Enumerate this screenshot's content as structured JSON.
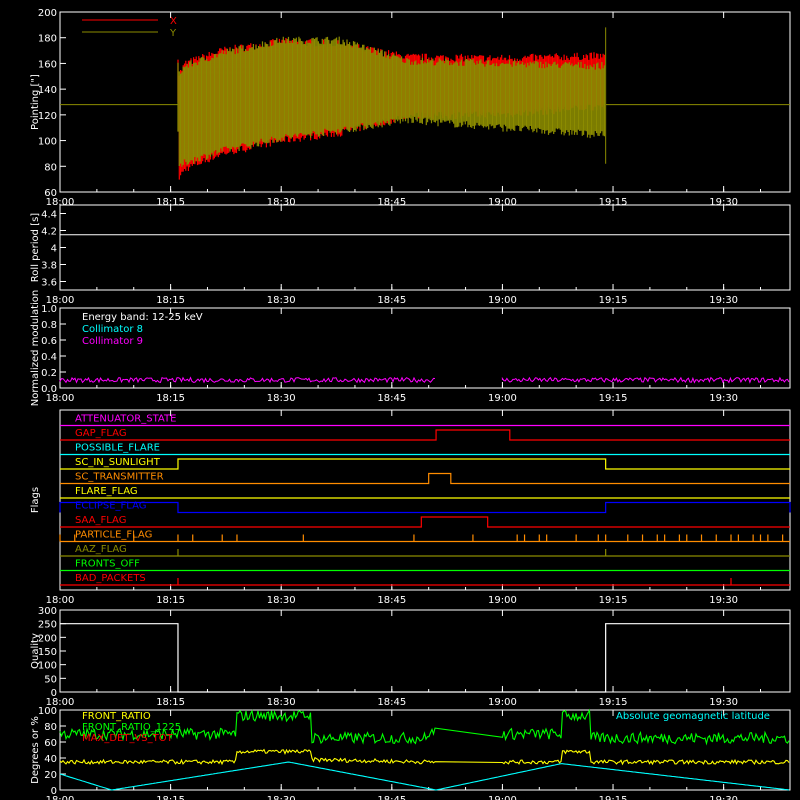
{
  "time_axis": {
    "start_min": 0,
    "end_min": 99,
    "tick_step_min": 15,
    "tick_labels": [
      "18:00",
      "18:15",
      "18:30",
      "18:45",
      "19:00",
      "19:15",
      "19:30"
    ]
  },
  "colors": {
    "x": "#ff0000",
    "y": "#8b8b00",
    "white": "#ffffff",
    "c8": "#00ffff",
    "c9": "#ff00ff",
    "green": "#00ff00",
    "yellow": "#ffff00",
    "orange": "#ff8c00",
    "blue": "#0000ff",
    "red": "#ff0000"
  },
  "chart_data": [
    {
      "type": "line",
      "ylabel": "Pointing [\"]",
      "ylim": [
        60,
        200
      ],
      "yticks": [
        60,
        80,
        100,
        120,
        140,
        160,
        180,
        200
      ],
      "legend": [
        {
          "name": "X",
          "color": "#ff0000"
        },
        {
          "name": "Y",
          "color": "#8b8b00"
        }
      ],
      "constant_before_after": 128,
      "data_interval_time": [
        "18:16",
        "19:14"
      ],
      "series": [
        {
          "name": "X",
          "envelope": {
            "time": [
              "18:16",
              "18:17",
              "18:22",
              "18:30",
              "18:38",
              "18:47",
              "19:00",
              "19:14"
            ],
            "upper": [
              150,
              160,
              170,
              177,
              175,
              165,
              164,
              166
            ],
            "lower": [
              70,
              78,
              90,
              100,
              106,
              119,
              120,
              127
            ]
          }
        },
        {
          "name": "Y",
          "envelope": {
            "time": [
              "18:16",
              "18:17",
              "18:22",
              "18:30",
              "18:38",
              "18:47",
              "19:00",
              "19:14"
            ],
            "upper": [
              152,
              158,
              168,
              178,
              178,
              162,
              160,
              158
            ],
            "lower": [
              78,
              83,
              92,
              102,
              108,
              116,
              110,
              104
            ]
          }
        }
      ]
    },
    {
      "type": "line",
      "ylabel": "Roll period [s]",
      "ylim": [
        3.5,
        4.5
      ],
      "yticks": [
        3.6,
        3.8,
        4.0,
        4.2,
        4.4
      ],
      "series": [
        {
          "name": "",
          "time": [
            "18:00",
            "19:39"
          ],
          "values": [
            4.15,
            4.15
          ]
        }
      ]
    },
    {
      "type": "line",
      "ylabel": "Normalized modulation",
      "ylim": [
        0,
        1
      ],
      "yticks": [
        0.0,
        0.2,
        0.4,
        0.6,
        0.8,
        1.0
      ],
      "legend_title": "Energy band: 12-25 keV",
      "legend": [
        {
          "name": "Collimator 8",
          "color": "#00ffff"
        },
        {
          "name": "Collimator 9",
          "color": "#ff00ff"
        }
      ],
      "segments": [
        {
          "start": "18:00",
          "end": "18:51",
          "level": 0.1
        },
        {
          "start": "19:00",
          "end": "19:39",
          "level": 0.1
        }
      ]
    },
    {
      "type": "line",
      "ylabel": "Flags",
      "flags": [
        {
          "name": "ATTENUATOR_STATE",
          "color": "#ff00ff",
          "high": []
        },
        {
          "name": "GAP_FLAG",
          "color": "#ff0000",
          "high": [
            [
              "18:51",
              "19:01"
            ]
          ]
        },
        {
          "name": "POSSIBLE_FLARE",
          "color": "#00ffff",
          "high": []
        },
        {
          "name": "SC_IN_SUNLIGHT",
          "color": "#ffff00",
          "high": [
            [
              "18:16",
              "19:14"
            ]
          ]
        },
        {
          "name": "SC_TRANSMITTER",
          "color": "#ff8c00",
          "high": [
            [
              "18:50",
              "18:53"
            ]
          ]
        },
        {
          "name": "FLARE_FLAG",
          "color": "#ffff00",
          "high": []
        },
        {
          "name": "ECLIPSE_FLAG",
          "color": "#0000ff",
          "high": [
            [
              "18:00",
              "18:16"
            ],
            [
              "19:14",
              "19:39"
            ]
          ]
        },
        {
          "name": "SAA_FLAG",
          "color": "#ff0000",
          "high": [
            [
              "18:49",
              "18:58"
            ]
          ]
        },
        {
          "name": "PARTICLE_FLAG",
          "color": "#ff8c00",
          "spikes_min": [
            0,
            2,
            10,
            16,
            18,
            22,
            24,
            33,
            48,
            56,
            62,
            63,
            65,
            66,
            70,
            73,
            74,
            77,
            79,
            81,
            82,
            84,
            85,
            87,
            89,
            91,
            92,
            94,
            95,
            96,
            98
          ]
        },
        {
          "name": "AAZ_FLAG",
          "color": "#8b8b00",
          "spikes_min": [
            16,
            74
          ]
        },
        {
          "name": "FRONTS_OFF",
          "color": "#00ff00",
          "high": []
        },
        {
          "name": "BAD_PACKETS",
          "color": "#ff0000",
          "spikes_min": [
            16,
            91
          ]
        }
      ]
    },
    {
      "type": "line",
      "ylabel": "Quality",
      "ylim": [
        0,
        300
      ],
      "yticks": [
        0,
        50,
        100,
        150,
        200,
        250,
        300
      ],
      "segments": [
        {
          "start": "18:00",
          "end": "18:16",
          "level": 250
        },
        {
          "start": "19:14",
          "end": "19:39",
          "level": 250
        }
      ]
    },
    {
      "type": "line",
      "ylabel": "Degrees or %",
      "ylim": [
        0,
        100
      ],
      "yticks": [
        0,
        20,
        40,
        60,
        80,
        100
      ],
      "legend": [
        {
          "name": "FRONT_RATIO",
          "color": "#ffff00"
        },
        {
          "name": "FRONT_RATIO_1225",
          "color": "#00ff00"
        },
        {
          "name": "MAX_DET_VS_TOT",
          "color": "#ff0000"
        }
      ],
      "annotation": "Absolute geomagnetic latitude",
      "series": [
        {
          "name": "FRONT_RATIO_1225",
          "time": [
            "18:00",
            "18:24",
            "18:24",
            "18:34",
            "18:34",
            "18:50",
            "18:50",
            "19:00",
            "19:00",
            "19:08",
            "19:08",
            "19:12",
            "19:12",
            "19:39"
          ],
          "values": [
            70,
            70,
            93,
            93,
            65,
            65,
            72,
            72,
            70,
            70,
            93,
            93,
            65,
            65
          ]
        },
        {
          "name": "FRONT_RATIO",
          "time": [
            "18:00",
            "18:24",
            "18:24",
            "18:34",
            "18:34",
            "18:50",
            "19:00",
            "19:08",
            "19:08",
            "19:12",
            "19:12",
            "19:39"
          ],
          "values": [
            35,
            35,
            48,
            48,
            38,
            35,
            35,
            35,
            48,
            48,
            35,
            35
          ]
        },
        {
          "name": "Absolute geomagnetic latitude",
          "time": [
            "18:00",
            "18:07",
            "18:31",
            "18:51",
            "19:08",
            "19:39"
          ],
          "values": [
            20,
            0,
            35,
            0,
            33,
            0
          ]
        }
      ]
    }
  ]
}
